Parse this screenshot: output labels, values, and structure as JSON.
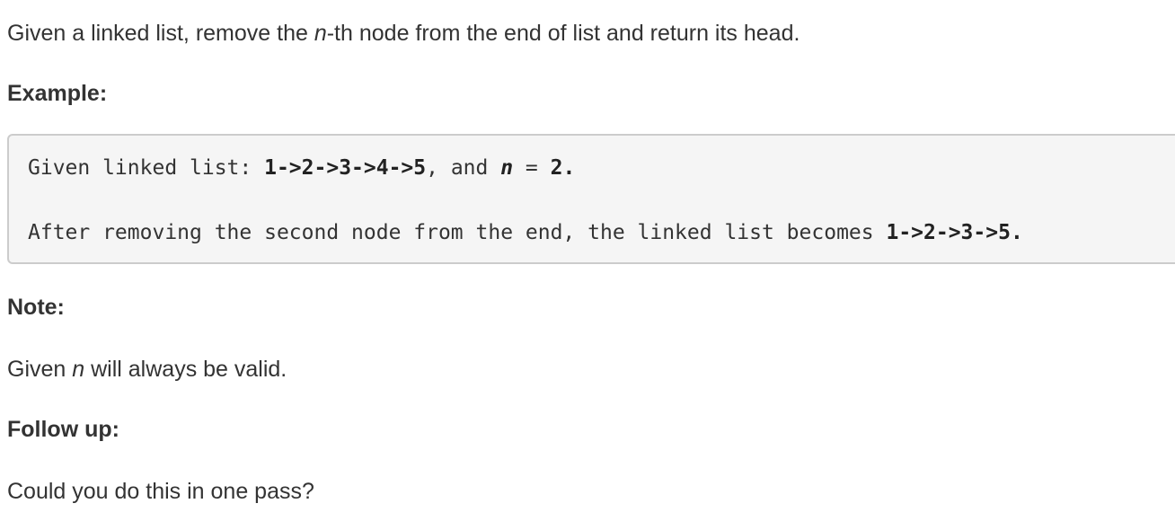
{
  "intro": {
    "before": "Given a linked list, remove the ",
    "var": "n",
    "after": "-th node from the end of list and return its head."
  },
  "example": {
    "heading": "Example:",
    "line1": {
      "prefix": "Given linked list: ",
      "list": "1->2->3->4->5",
      "middle": ", and ",
      "var": "n",
      "equals": " = ",
      "value": "2.",
      "suffix": ""
    },
    "line2": {
      "prefix": "After removing the second node from the end, the linked list becomes ",
      "list": "1->2->3->5."
    }
  },
  "note": {
    "heading": "Note:",
    "before": "Given ",
    "var": "n",
    "after": " will always be valid."
  },
  "follow_up": {
    "heading": "Follow up:",
    "text": "Could you do this in one pass?"
  },
  "colors": {
    "text": "#333333",
    "code_background": "#f5f5f5",
    "code_border": "#cccccc"
  }
}
